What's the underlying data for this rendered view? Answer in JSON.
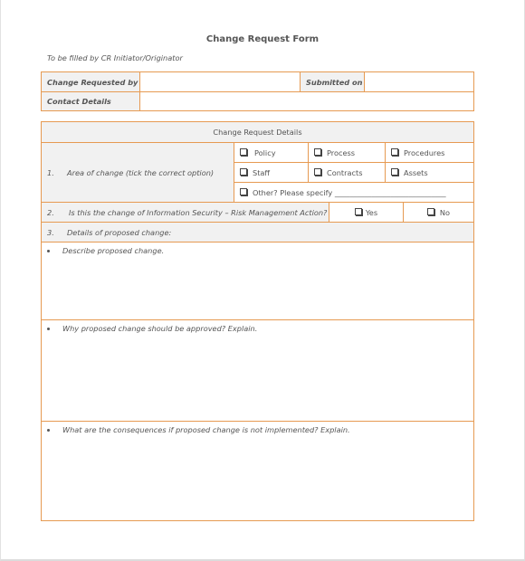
{
  "form": {
    "title": "Change Request Form",
    "subtitle": "To be filled by CR Initiator/Originator"
  },
  "header_table": {
    "change_requested_by_label": "Change Requested by",
    "change_requested_by_value": "",
    "submitted_on_label": "Submitted on",
    "submitted_on_value": "",
    "contact_details_label": "Contact Details",
    "contact_details_value": ""
  },
  "details": {
    "heading": "Change Request Details",
    "q1": {
      "number": "1.",
      "text": "Area of change (tick  the correct option)",
      "options": [
        "Policy",
        "Process",
        "Procedures",
        "Staff",
        "Contracts",
        "Assets"
      ],
      "other": "Other? Please specify ______________________________"
    },
    "q2": {
      "number": "2.",
      "text": "Is this the change of Information Security – Risk Management Action?",
      "yes": "Yes",
      "no": "No"
    },
    "q3": {
      "number": "3.",
      "text": "Details of proposed change:"
    },
    "prompts": [
      "Describe proposed change.",
      "Why proposed change should be approved? Explain.",
      "What are the consequences if proposed change is not implemented? Explain."
    ]
  },
  "colors": {
    "border": "#e69a52",
    "label_bg": "#f1f1f1"
  }
}
